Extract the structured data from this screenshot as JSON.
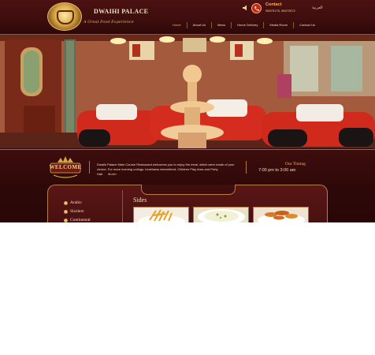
{
  "header": {
    "site_name": "DWAIHI PALACE",
    "tagline": "A Great Food Experience",
    "contact_title": "Contact",
    "contact_phones": "96575175, 96572572",
    "language_link": "العربية",
    "nav": [
      "Home",
      "About Us",
      "Menu",
      "Home Delivery",
      "Media Room",
      "Contact Us"
    ]
  },
  "intro": {
    "welcome": "WELCOME",
    "text": "Dwaihi Palace Main Course Restaurant welcomes you to enjoy the meal, which were made of your choice. For more evening outings, loneliness intermittent, Children Play Area and Party Hall.",
    "more": "More»",
    "timing_title": "Our Timing",
    "timing_hours": "7:00 pm  to  3:00 am"
  },
  "menu": {
    "categories": [
      "Arabic",
      "Sizzlers",
      "Continental"
    ],
    "section_title": "Sides",
    "dishes": [
      "french-fries",
      "creamy-dip",
      "fried-bites"
    ]
  },
  "colors": {
    "maroon": "#3b0c0c",
    "gold": "#b88040",
    "accent_orange": "#ffb060"
  }
}
